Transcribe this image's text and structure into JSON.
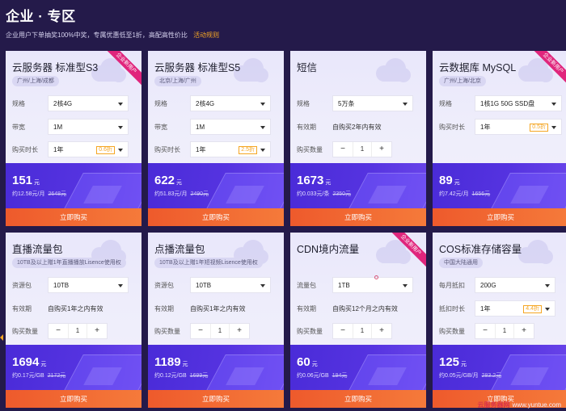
{
  "header": {
    "title": "企业 · 专区",
    "subtitle": "企业用户下单抽奖100%中奖，专属优惠低至1折，高配高性价比",
    "rules_link": "活动规则"
  },
  "common": {
    "buy_label": "立即购买",
    "yuan": "元",
    "ribbon_text": "企业新用户"
  },
  "cards": [
    {
      "title": "云服务器 标准型S3",
      "tag": "广州/上海/成都",
      "rows": [
        {
          "label": "规格",
          "value": "2核4G"
        },
        {
          "label": "带宽",
          "value": "1M"
        },
        {
          "label": "购买时长",
          "value": "1年",
          "discount": "0.6折"
        }
      ],
      "price": "151",
      "per_unit": "约12.58元/月",
      "original": "2648元"
    },
    {
      "title": "云服务器 标准型S5",
      "tag": "北京/上海/广州",
      "rows": [
        {
          "label": "规格",
          "value": "2核4G"
        },
        {
          "label": "带宽",
          "value": "1M"
        },
        {
          "label": "购买时长",
          "value": "1年",
          "discount": "2.5折"
        }
      ],
      "price": "622",
      "per_unit": "约51.83元/月",
      "original": "2490元"
    },
    {
      "title": "短信",
      "rows": [
        {
          "label": "规格",
          "value": "5万条"
        },
        {
          "label": "有效期",
          "text": "自购买2年内有效"
        },
        {
          "label": "购买数量",
          "quantity": "1"
        }
      ],
      "price": "1673",
      "per_unit": "约0.033元/条",
      "original": "2350元"
    },
    {
      "title": "云数据库 MySQL",
      "tag": "广州/上海/北京",
      "rows": [
        {
          "label": "规格",
          "value": "1核1G 50G SSD盘"
        },
        {
          "label": "购买时长",
          "value": "1年",
          "discount": "0.5折"
        }
      ],
      "price": "89",
      "per_unit": "约7.42元/月",
      "original": "1656元"
    },
    {
      "title": "直播流量包",
      "tag": "10TB及以上赠1年直播播放Lisence使用权",
      "rows": [
        {
          "label": "资源包",
          "value": "10TB"
        },
        {
          "label": "有效期",
          "text": "自购买1年之内有效"
        },
        {
          "label": "购买数量",
          "quantity": "1"
        }
      ],
      "price": "1694",
      "per_unit": "约0.17元/GB",
      "original": "2172元"
    },
    {
      "title": "点播流量包",
      "tag": "10TB及以上赠1年短视频Lisence使用权",
      "rows": [
        {
          "label": "资源包",
          "value": "10TB"
        },
        {
          "label": "有效期",
          "text": "自购买1年之内有效"
        },
        {
          "label": "购买数量",
          "quantity": "1"
        }
      ],
      "price": "1189",
      "per_unit": "约0.12元/GB",
      "original": "1699元"
    },
    {
      "title": "CDN境内流量",
      "rows": [
        {
          "label": "流量包",
          "value": "1TB"
        },
        {
          "label": "有效期",
          "text": "自购买12个月之内有效"
        },
        {
          "label": "购买数量",
          "quantity": "1"
        }
      ],
      "price": "60",
      "per_unit": "约0.06元/GB",
      "original": "194元"
    },
    {
      "title": "COS标准存储容量",
      "tag": "中国大陆通用",
      "rows": [
        {
          "label": "每月抵扣",
          "value": "200G"
        },
        {
          "label": "抵扣时长",
          "value": "1年",
          "discount": "4.4折"
        },
        {
          "label": "购买数量",
          "quantity": "1"
        }
      ],
      "price": "125",
      "per_unit": "约0.05元/GB/月",
      "original": "283.2元"
    }
  ],
  "watermark": {
    "a": "云服务器网",
    "b": "www.yuntue.com"
  },
  "colors": {
    "background": "#241a4a",
    "card_bg": "#ecebfb",
    "price_band": "#5533e0",
    "buy_button": "#f26a33",
    "discount": "#f5a623",
    "ribbon": "#e0257c"
  }
}
